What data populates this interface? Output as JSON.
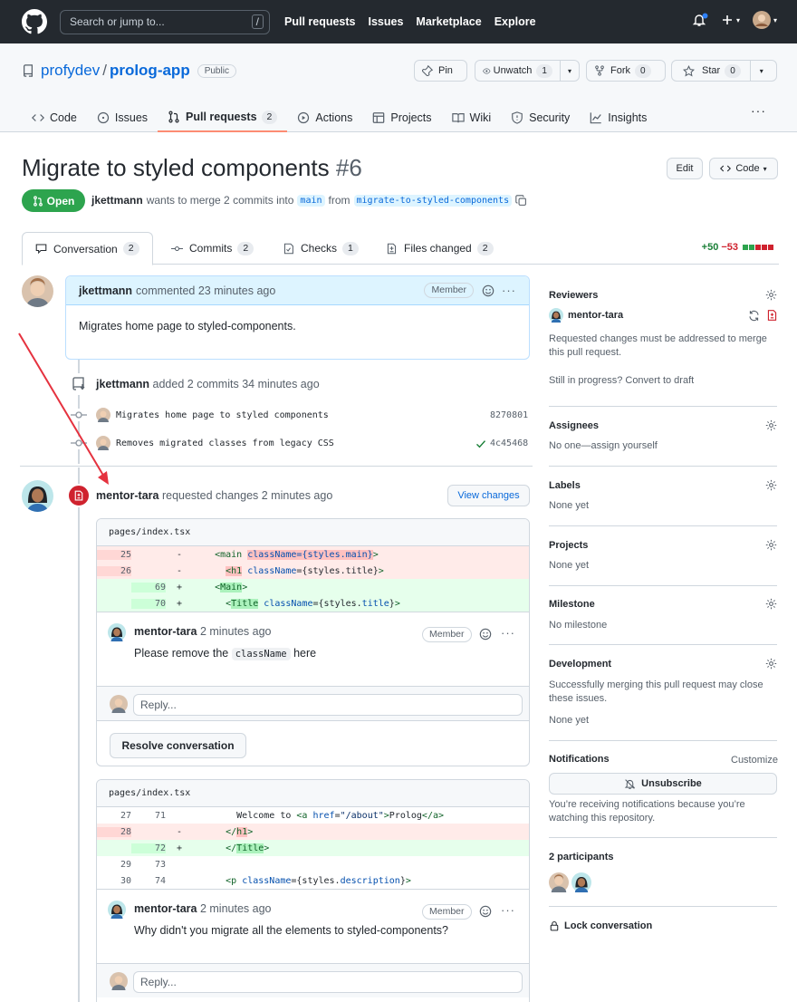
{
  "header": {
    "search_placeholder": "Search or jump to...",
    "search_kbd": "/",
    "nav": [
      "Pull requests",
      "Issues",
      "Marketplace",
      "Explore"
    ]
  },
  "repo": {
    "owner": "profydev",
    "sep": "/",
    "name": "prolog-app",
    "visibility": "Public",
    "pin_label": "Pin",
    "watch_label": "Unwatch",
    "watch_count": "1",
    "fork_label": "Fork",
    "fork_count": "0",
    "star_label": "Star",
    "star_count": "0",
    "tabs": [
      {
        "label": "Code",
        "count": ""
      },
      {
        "label": "Issues",
        "count": ""
      },
      {
        "label": "Pull requests",
        "count": "2"
      },
      {
        "label": "Actions",
        "count": ""
      },
      {
        "label": "Projects",
        "count": ""
      },
      {
        "label": "Wiki",
        "count": ""
      },
      {
        "label": "Security",
        "count": ""
      },
      {
        "label": "Insights",
        "count": ""
      }
    ],
    "more": "···"
  },
  "pr": {
    "title": "Migrate to styled components",
    "number": "#6",
    "edit_label": "Edit",
    "code_label": "Code",
    "state": "Open",
    "author": "jkettmann",
    "meta_1": "wants to merge 2 commits into",
    "base": "main",
    "meta_2": "from",
    "head": "migrate-to-styled-components",
    "tabs": [
      {
        "label": "Conversation",
        "count": "2"
      },
      {
        "label": "Commits",
        "count": "2"
      },
      {
        "label": "Checks",
        "count": "1"
      },
      {
        "label": "Files changed",
        "count": "2"
      }
    ],
    "additions": "+50",
    "deletions": "−53"
  },
  "timeline": {
    "first_comment": {
      "author": "jkettmann",
      "action": "commented 23 minutes ago",
      "badge": "Member",
      "body": "Migrates home page to styled-components."
    },
    "commits_event": {
      "author": "jkettmann",
      "action": "added 2 commits 34 minutes ago"
    },
    "commits": [
      {
        "message": "Migrates home page to styled components",
        "sha": "8270801"
      },
      {
        "message": "Removes migrated classes from legacy CSS",
        "sha": "4c45468"
      }
    ],
    "review": {
      "author": "mentor-tara",
      "action": "requested changes 2 minutes ago",
      "view_changes": "View changes"
    },
    "thread1": {
      "file": "pages/index.tsx",
      "lines": [
        {
          "old": "25",
          "new": "",
          "sign": "-",
          "type": "del"
        },
        {
          "old": "26",
          "new": "",
          "sign": "-",
          "type": "del"
        },
        {
          "old": "",
          "new": "69",
          "sign": "+",
          "type": "add"
        },
        {
          "old": "",
          "new": "70",
          "sign": "+",
          "type": "add"
        }
      ],
      "comment_author": "mentor-tara",
      "comment_time": "2 minutes ago",
      "badge": "Member",
      "body_pre": "Please remove the",
      "body_code": "className",
      "body_post": "here",
      "reply_placeholder": "Reply...",
      "resolve": "Resolve conversation"
    },
    "thread2": {
      "file": "pages/index.tsx",
      "lines": [
        {
          "old": "27",
          "new": "71",
          "sign": "",
          "type": "ctx"
        },
        {
          "old": "28",
          "new": "",
          "sign": "-",
          "type": "del"
        },
        {
          "old": "",
          "new": "72",
          "sign": "+",
          "type": "add"
        },
        {
          "old": "29",
          "new": "73",
          "sign": "",
          "type": "ctx"
        },
        {
          "old": "30",
          "new": "74",
          "sign": "",
          "type": "ctx"
        }
      ],
      "comment_author": "mentor-tara",
      "comment_time": "2 minutes ago",
      "badge": "Member",
      "body": "Why didn't you migrate all the elements to styled-components?",
      "reply_placeholder": "Reply..."
    }
  },
  "sidebar": {
    "reviewers_h": "Reviewers",
    "reviewer": "mentor-tara",
    "reviewers_note": "Requested changes must be addressed to merge this pull request.",
    "draft_note": "Still in progress? Convert to draft",
    "assignees_h": "Assignees",
    "assignees_v": "No one—assign yourself",
    "labels_h": "Labels",
    "labels_v": "None yet",
    "projects_h": "Projects",
    "projects_v": "None yet",
    "milestone_h": "Milestone",
    "milestone_v": "No milestone",
    "development_h": "Development",
    "development_note": "Successfully merging this pull request may close these issues.",
    "development_v": "None yet",
    "notifications_h": "Notifications",
    "customize": "Customize",
    "unsubscribe": "Unsubscribe",
    "notif_note": "You’re receiving notifications because you’re watching this repository.",
    "participants_h": "2 participants",
    "lock": "Lock conversation"
  },
  "colors": {
    "header_bg": "#24292f",
    "accent_link": "#0969da",
    "open_green": "#2da44e",
    "changes_red": "#cf222e",
    "annotation_arrow": "#e5323f"
  }
}
